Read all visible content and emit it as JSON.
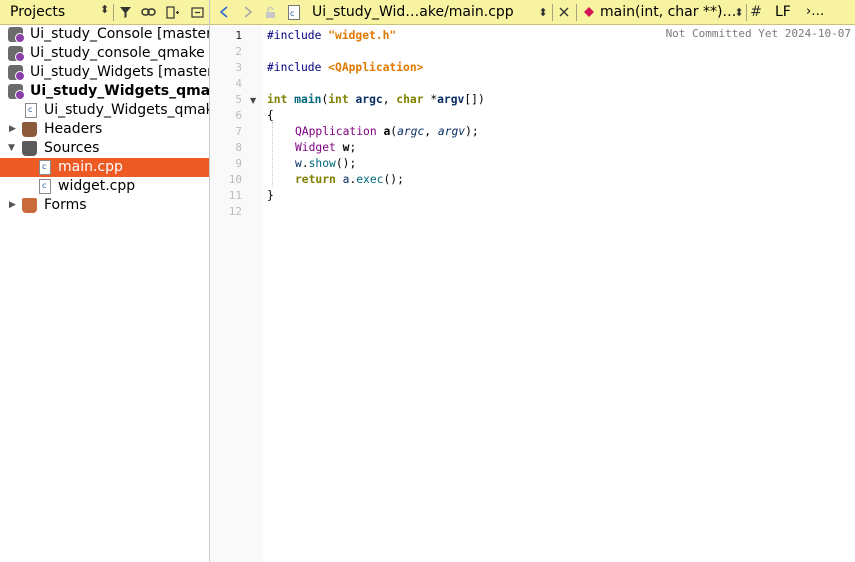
{
  "projects_pane": {
    "title": "Projects",
    "tree": [
      {
        "label": "Ui_study_Console [master]",
        "type": "project",
        "bold": false
      },
      {
        "label": "Ui_study_console_qmake [master]",
        "type": "project",
        "bold": false
      },
      {
        "label": "Ui_study_Widgets [master]",
        "type": "project",
        "bold": false
      },
      {
        "label": "Ui_study_Widgets_qmake",
        "type": "project",
        "bold": true
      },
      {
        "label": "Ui_study_Widgets_qmake.pro",
        "type": "pro-file"
      },
      {
        "label": "Headers",
        "type": "folder"
      },
      {
        "label": "Sources",
        "type": "folder"
      },
      {
        "label": "main.cpp",
        "type": "file",
        "selected": true
      },
      {
        "label": "widget.cpp",
        "type": "file"
      },
      {
        "label": "Forms",
        "type": "folder"
      }
    ]
  },
  "editor_toolbar": {
    "file_title": "Ui_study_Wid…ake/main.cpp",
    "function_title": "main(int, char **)…",
    "hash_label": "#",
    "line_ending": "LF",
    "more_label": "›…"
  },
  "editor": {
    "blame": "Not Committed Yet 2024-10-07",
    "line_numbers": [
      "1",
      "2",
      "3",
      "4",
      "5",
      "6",
      "7",
      "8",
      "9",
      "10",
      "11",
      "12"
    ],
    "code": {
      "l1_pp": "#include ",
      "l1_str": "\"widget.h\"",
      "l3_pp": "#include ",
      "l3_str": "<QApplication>",
      "l5_int": "int",
      "l5_main": "main",
      "l5_paren": "(",
      "l5_int2": "int",
      "l5_argc": "argc",
      "l5_comma": ", ",
      "l5_char": "char",
      "l5_star": " *",
      "l5_argv": "argv",
      "l5_end": "[])",
      "l6": "{",
      "l7_cls": "QApplication",
      "l7_a": "a",
      "l7_open": "(",
      "l7_argc": "argc",
      "l7_comma": ", ",
      "l7_argv": "argv",
      "l7_end": ");",
      "l8_cls": "Widget",
      "l8_w": "w",
      "l8_end": ";",
      "l9_w": "w",
      "l9_dot": ".",
      "l9_show": "show",
      "l9_end": "();",
      "l10_ret": "return",
      "l10_a": "a",
      "l10_dot": ".",
      "l10_exec": "exec",
      "l10_end": "();",
      "l11": "}"
    }
  }
}
